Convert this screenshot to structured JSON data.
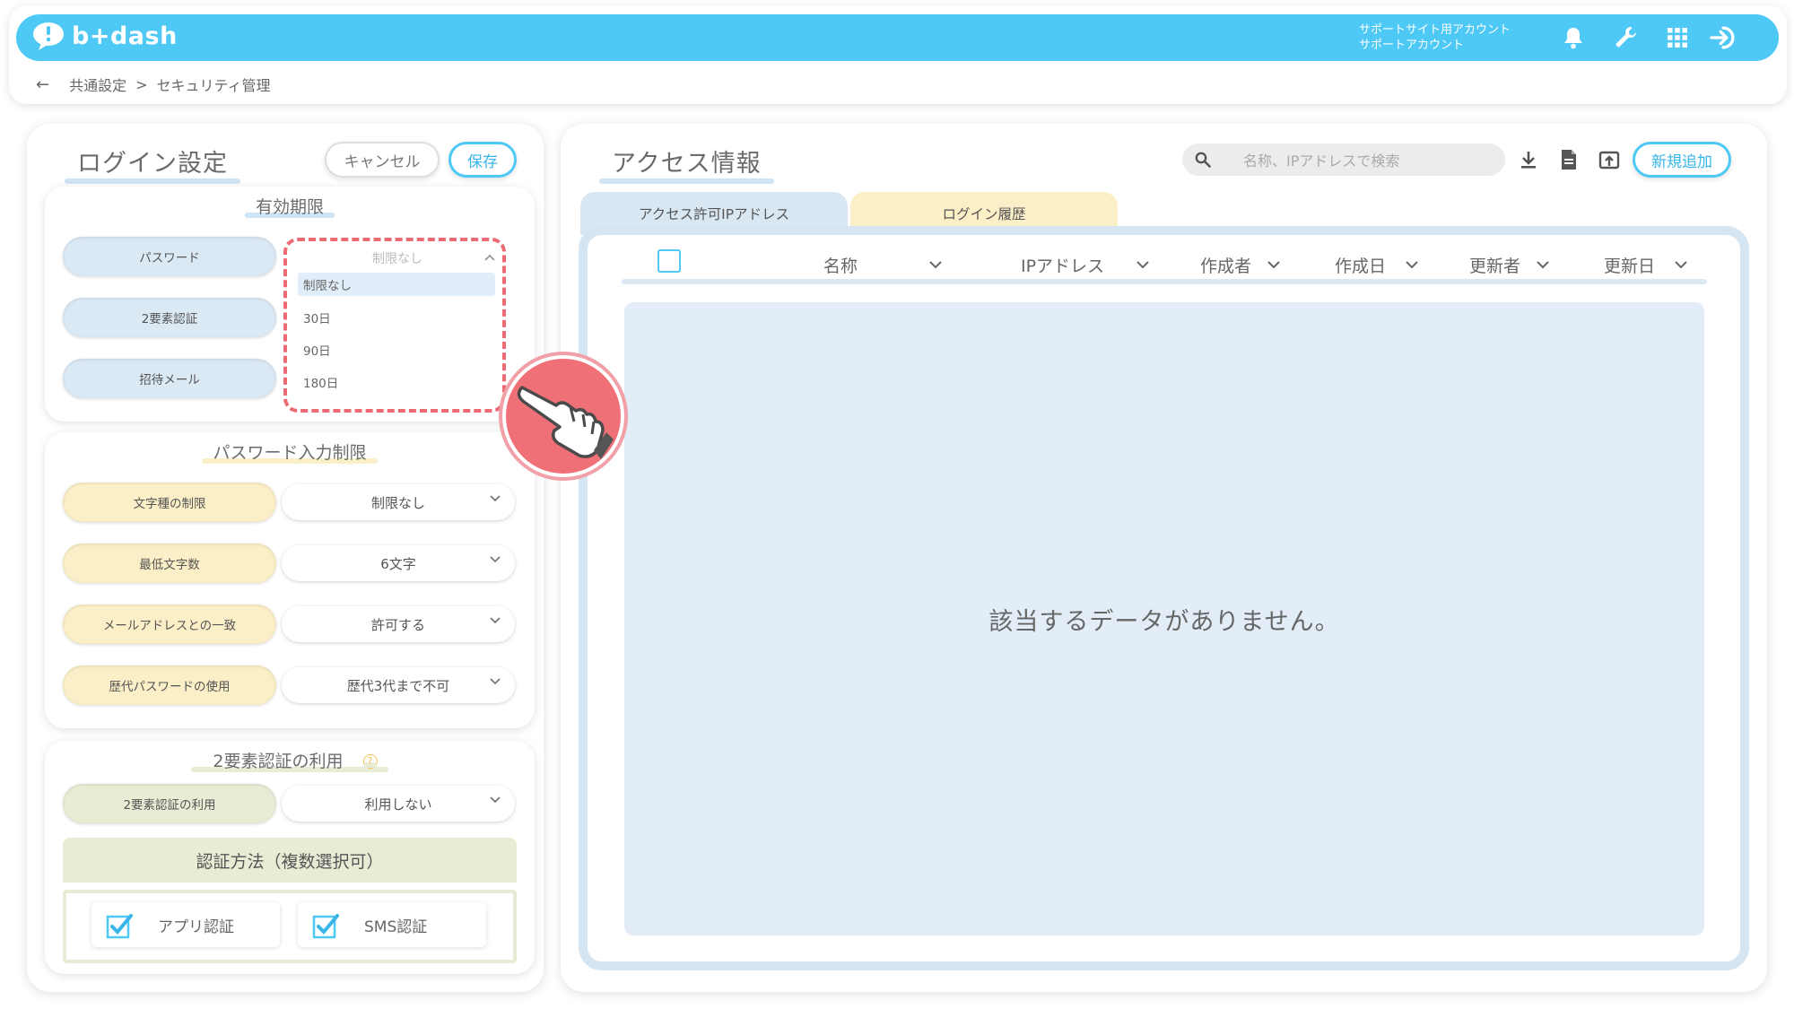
{
  "header": {
    "logo_text": "b+dash",
    "account_line1": "サポートサイト用アカウント",
    "account_line2": "サポートアカウント",
    "icons": [
      "bell-icon",
      "wrench-icon",
      "grid-icon",
      "logout-icon"
    ],
    "accent_color": "#4ec8f4"
  },
  "breadcrumb": {
    "back_icon": "←",
    "item1": "共通設定",
    "separator": ">",
    "item2": "セキュリティ管理"
  },
  "login_settings": {
    "title": "ログイン設定",
    "cancel_label": "キャンセル",
    "save_label": "保存",
    "expiry": {
      "title": "有効期限",
      "rows": [
        {
          "label": "パスワード",
          "value": "制限なし"
        },
        {
          "label": "2要素認証",
          "value": ""
        },
        {
          "label": "招待メール",
          "value": ""
        }
      ],
      "dropdown": {
        "current": "制限なし",
        "options": [
          "制限なし",
          "30日",
          "90日",
          "180日"
        ],
        "selected_index": 0
      }
    },
    "password_rules": {
      "title": "パスワード入力制限",
      "rows": [
        {
          "label": "文字種の制限",
          "value": "制限なし"
        },
        {
          "label": "最低文字数",
          "value": "6文字"
        },
        {
          "label": "メールアドレスとの一致",
          "value": "許可する"
        },
        {
          "label": "歴代パスワードの使用",
          "value": "歴代3代まで不可"
        }
      ]
    },
    "two_factor": {
      "title": "2要素認証の利用",
      "help_icon": "?",
      "row": {
        "label": "2要素認証の利用",
        "value": "利用しない"
      },
      "methods_title": "認証方法（複数選択可）",
      "methods": [
        {
          "label": "アプリ認証",
          "checked": true
        },
        {
          "label": "SMS認証",
          "checked": true
        }
      ]
    }
  },
  "access_info": {
    "title": "アクセス情報",
    "search_placeholder": "名称、IPアドレスで検索",
    "new_button": "新規追加",
    "tabs": [
      "アクセス許可IPアドレス",
      "ログイン履歴"
    ],
    "columns": [
      "名称",
      "IPアドレス",
      "作成者",
      "作成日",
      "更新者",
      "更新日"
    ],
    "empty_message": "該当するデータがありません。"
  }
}
